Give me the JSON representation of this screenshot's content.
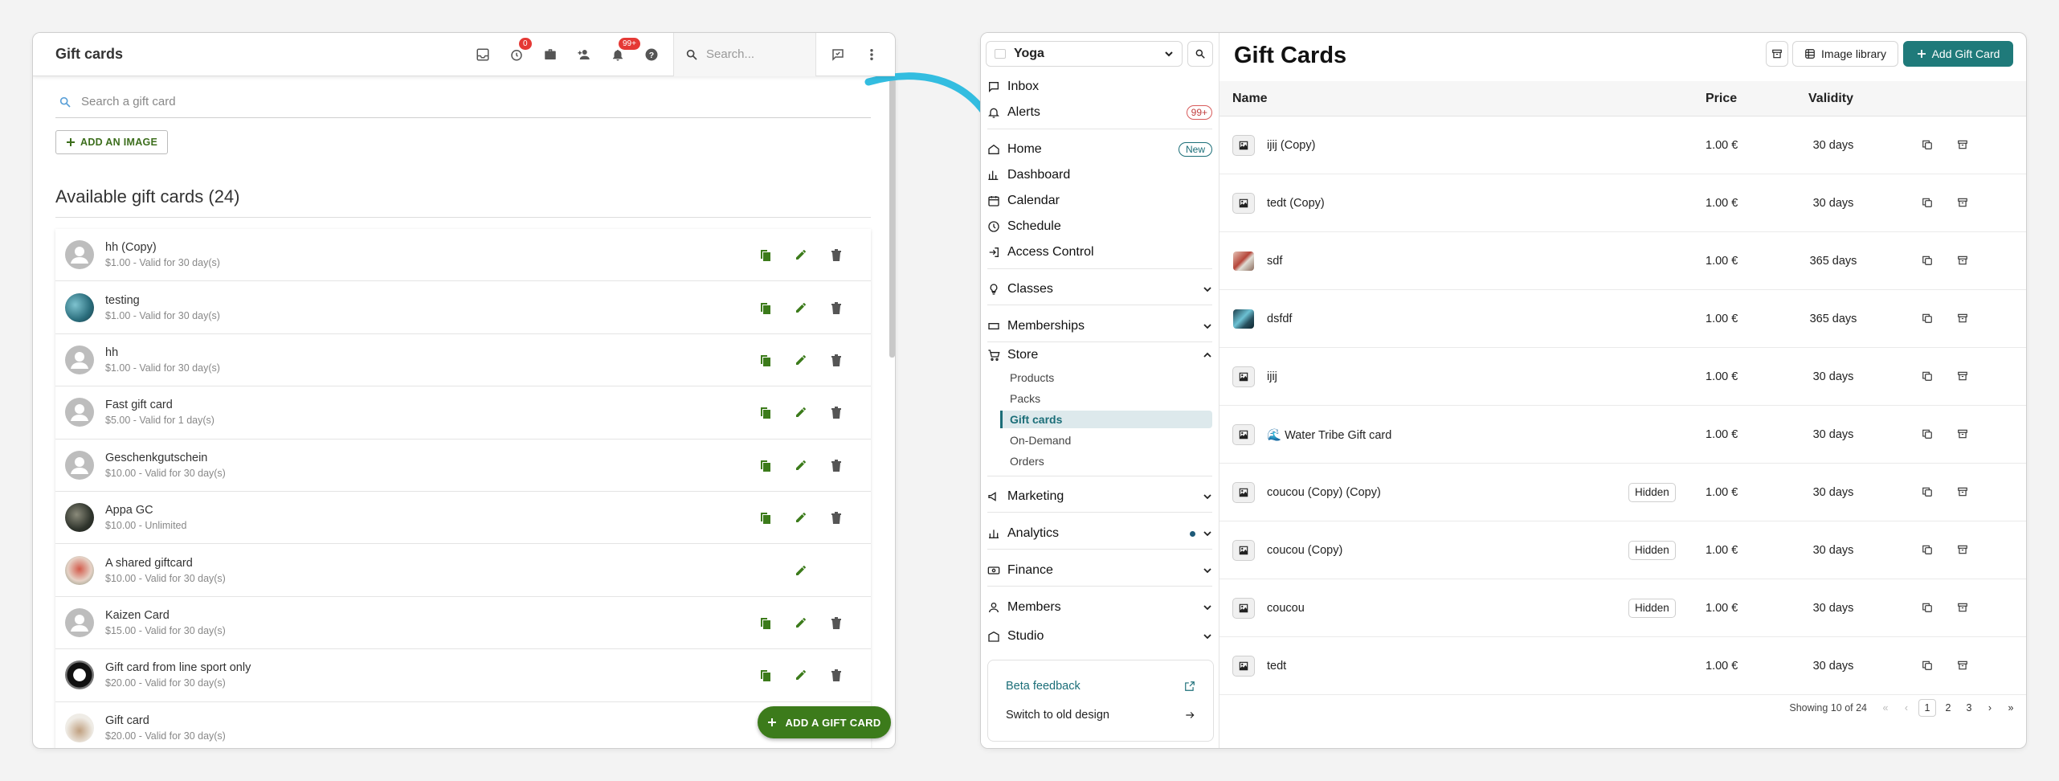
{
  "old_ui": {
    "title": "Gift cards",
    "badges": {
      "timer": "0",
      "notifications": "99+"
    },
    "search_placeholder": "Search...",
    "giftcard_search_placeholder": "Search a gift card",
    "add_image_label": "ADD AN IMAGE",
    "heading": "Available gift cards (24)",
    "items": [
      {
        "name": "hh (Copy)",
        "sub": "$1.00 - Valid for 30 day(s)",
        "avatar": "default",
        "actions": [
          "copy",
          "edit",
          "delete"
        ]
      },
      {
        "name": "testing",
        "sub": "$1.00 - Valid for 30 day(s)",
        "avatar": "photo-teal",
        "actions": [
          "copy",
          "edit",
          "delete"
        ]
      },
      {
        "name": "hh",
        "sub": "$1.00 - Valid for 30 day(s)",
        "avatar": "default",
        "actions": [
          "copy",
          "edit",
          "delete"
        ]
      },
      {
        "name": "Fast gift card",
        "sub": "$5.00 - Valid for 1 day(s)",
        "avatar": "default",
        "actions": [
          "copy",
          "edit",
          "delete"
        ]
      },
      {
        "name": "Geschenkgutschein",
        "sub": "$10.00 - Valid for 30 day(s)",
        "avatar": "default",
        "actions": [
          "copy",
          "edit",
          "delete"
        ]
      },
      {
        "name": "Appa GC",
        "sub": "$10.00 - Unlimited",
        "avatar": "photo-dark",
        "actions": [
          "copy",
          "edit",
          "delete"
        ]
      },
      {
        "name": "A shared giftcard",
        "sub": "$10.00 - Valid for 30 day(s)",
        "avatar": "photo-red",
        "actions": [
          "edit"
        ]
      },
      {
        "name": "Kaizen Card",
        "sub": "$15.00 - Valid for 30 day(s)",
        "avatar": "default",
        "actions": [
          "copy",
          "edit",
          "delete"
        ]
      },
      {
        "name": "Gift card from line sport only",
        "sub": "$20.00 - Valid for 30 day(s)",
        "avatar": "photo-black",
        "actions": [
          "copy",
          "edit",
          "delete"
        ]
      },
      {
        "name": "Gift card",
        "sub": "$20.00 - Valid for 30 day(s)",
        "avatar": "photo-light",
        "actions": []
      }
    ],
    "fab_label": "ADD A GIFT CARD"
  },
  "new_ui": {
    "studio": "Yoga",
    "nav": {
      "inbox": "Inbox",
      "alerts": "Alerts",
      "alerts_badge": "99+",
      "home": "Home",
      "home_badge": "New",
      "dashboard": "Dashboard",
      "calendar": "Calendar",
      "schedule": "Schedule",
      "access": "Access Control",
      "classes": "Classes",
      "memberships": "Memberships",
      "store": "Store",
      "store_sub": [
        "Products",
        "Packs",
        "Gift cards",
        "On-Demand",
        "Orders"
      ],
      "marketing": "Marketing",
      "analytics": "Analytics",
      "finance": "Finance",
      "members": "Members",
      "studio": "Studio"
    },
    "beta_feedback": "Beta feedback",
    "switch_old": "Switch to old design",
    "title": "Gift Cards",
    "image_library": "Image library",
    "add_button": "Add Gift Card",
    "columns": {
      "name": "Name",
      "price": "Price",
      "validity": "Validity"
    },
    "rows": [
      {
        "name": "ijij (Copy)",
        "hidden": "",
        "price": "1.00 €",
        "validity": "30 days",
        "thumb": "placeholder"
      },
      {
        "name": "tedt (Copy)",
        "hidden": "",
        "price": "1.00 €",
        "validity": "30 days",
        "thumb": "placeholder"
      },
      {
        "name": "sdf",
        "hidden": "",
        "price": "1.00 €",
        "validity": "365 days",
        "thumb": "photo-red"
      },
      {
        "name": "dsfdf",
        "hidden": "",
        "price": "1.00 €",
        "validity": "365 days",
        "thumb": "photo-teal"
      },
      {
        "name": "ijij",
        "hidden": "",
        "price": "1.00 €",
        "validity": "30 days",
        "thumb": "placeholder"
      },
      {
        "name": "🌊 Water Tribe Gift card",
        "hidden": "",
        "price": "1.00 €",
        "validity": "30 days",
        "thumb": "placeholder"
      },
      {
        "name": "coucou (Copy) (Copy)",
        "hidden": "Hidden",
        "price": "1.00 €",
        "validity": "30 days",
        "thumb": "placeholder"
      },
      {
        "name": "coucou (Copy)",
        "hidden": "Hidden",
        "price": "1.00 €",
        "validity": "30 days",
        "thumb": "placeholder"
      },
      {
        "name": "coucou",
        "hidden": "Hidden",
        "price": "1.00 €",
        "validity": "30 days",
        "thumb": "placeholder"
      },
      {
        "name": "tedt",
        "hidden": "",
        "price": "1.00 €",
        "validity": "30 days",
        "thumb": "placeholder"
      }
    ],
    "pagination": {
      "info": "Showing 10 of 24",
      "pages": [
        "1",
        "2",
        "3"
      ],
      "current": "1"
    }
  },
  "colors": {
    "old_green": "#3c7b1b",
    "teal": "#1f7a7a",
    "arrow": "#33bde0",
    "badge_red": "#e53935"
  }
}
